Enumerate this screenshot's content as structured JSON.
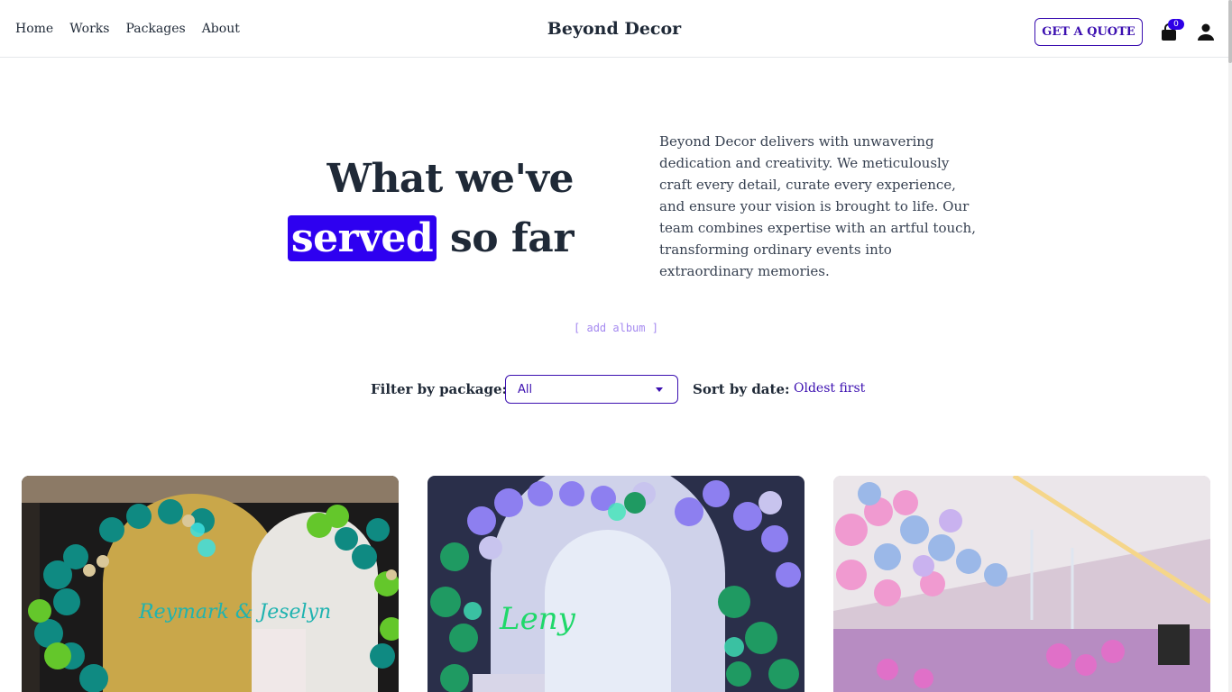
{
  "nav": {
    "items": [
      "Home",
      "Works",
      "Packages",
      "About"
    ],
    "brand": "Beyond Decor",
    "quote_button": "GET A QUOTE",
    "cart_count": "0"
  },
  "hero": {
    "title_line1": "What we've",
    "title_highlight": "served",
    "title_rest": "so far",
    "description": "Beyond Decor delivers with unwavering dedication and creativity. We meticulously craft every detail, curate every experience, and ensure your vision is brought to life. Our team combines expertise with an artful touch, transforming ordinary events into extraordinary memories."
  },
  "add_album": "[ add album ]",
  "filters": {
    "filter_label": "Filter by package:",
    "filter_selected": "All",
    "sort_label": "Sort by date:",
    "sort_value": "Oldest first"
  },
  "gallery": {
    "cards": [
      {
        "caption_script": "Reymark & Jeselyn"
      },
      {
        "caption_script": "Leny"
      },
      {
        "caption_script": ""
      }
    ]
  },
  "colors": {
    "accent": "#2e00f0",
    "accent_text": "#3b0fb0",
    "heading": "#1f2937",
    "muted_link": "#a58af0"
  },
  "icons": [
    "shopping-bag-icon",
    "user-icon",
    "chevron-down-icon"
  ]
}
